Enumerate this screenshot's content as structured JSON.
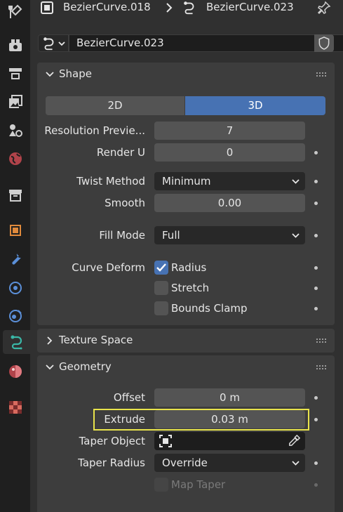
{
  "header": {
    "object_name": "BezierCurve.018",
    "data_name": "BezierCurve.023"
  },
  "datablock": {
    "name": "BezierCurve.023"
  },
  "shape": {
    "title": "Shape",
    "dim_2d": "2D",
    "dim_3d": "3D",
    "active_dim": "3D",
    "resolution_preview_label": "Resolution Previe...",
    "resolution_preview_value": "7",
    "render_u_label": "Render U",
    "render_u_value": "0",
    "twist_method_label": "Twist Method",
    "twist_method_value": "Minimum",
    "smooth_label": "Smooth",
    "smooth_value": "0.00",
    "fill_mode_label": "Fill Mode",
    "fill_mode_value": "Full",
    "curve_deform_label": "Curve Deform",
    "radius_label": "Radius",
    "radius_checked": true,
    "stretch_label": "Stretch",
    "stretch_checked": false,
    "bounds_clamp_label": "Bounds Clamp",
    "bounds_clamp_checked": false
  },
  "texture_space": {
    "title": "Texture Space"
  },
  "geometry": {
    "title": "Geometry",
    "offset_label": "Offset",
    "offset_value": "0 m",
    "extrude_label": "Extrude",
    "extrude_value": "0.03 m",
    "taper_object_label": "Taper Object",
    "taper_radius_label": "Taper Radius",
    "taper_radius_value": "Override",
    "map_taper_label": "Map Taper",
    "map_taper_checked": false
  },
  "colors": {
    "accent": "#4772b3",
    "highlight": "#e8e34b",
    "curve_icon": "#3ab7a7"
  },
  "tabs": [
    "tool-icon",
    "render-icon",
    "output-icon",
    "view-layer-icon",
    "scene-icon",
    "world-icon",
    "collection-icon",
    "object-icon",
    "modifier-icon",
    "particles-icon",
    "physics-icon",
    "curve-data-icon",
    "material-icon",
    "texture-icon"
  ]
}
